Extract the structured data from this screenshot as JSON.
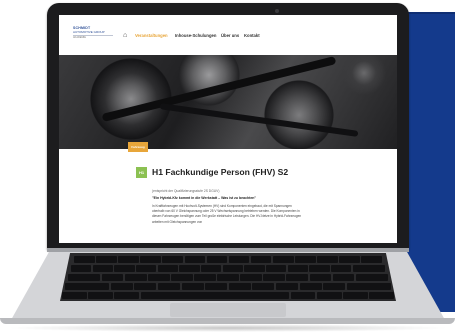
{
  "site": {
    "logo": {
      "line1": "SCHMIDT",
      "line2": "AUTOMOTIVE GROUP",
      "line3": "AKADEMIE"
    },
    "nav": [
      {
        "label": "Veranstaltungen",
        "active": true
      },
      {
        "label": "Inhouse-Schulungen",
        "active": false
      },
      {
        "label": "Über uns",
        "active": false
      },
      {
        "label": "Kontakt",
        "active": false
      }
    ],
    "hero": {
      "badge": "Fahrzeug"
    },
    "article": {
      "tag": "H1",
      "title": "H1 Fachkundige Person (FHV) S2",
      "subtitle": "(entspricht der Qualifizierungsstufe 2S DGUV)",
      "lead": "\"Ein Hybrid-Kfz kommt in die Werkstatt – Was ist zu beachten\"",
      "paragraph": "In Kraftfahrzeugen mit Hochvolt-Systemen (HV) sind Komponenten eingebaut, die mit Spannungen oberhalb von 60 V Gleichspannung oder 25 V Wechselspannung betrieben werden. Die Komponenten in diesen Fahrzeugen benötigen zum Teil große elektrische Leistungen. Die HV-Netze in Hybrid-Fahrzeugen arbeiten mit Gleichspannungen von"
    }
  },
  "colors": {
    "accent": "#e8a63a",
    "brand": "#2a4c95",
    "tag": "#8cc152",
    "panel": "#143a8c"
  }
}
